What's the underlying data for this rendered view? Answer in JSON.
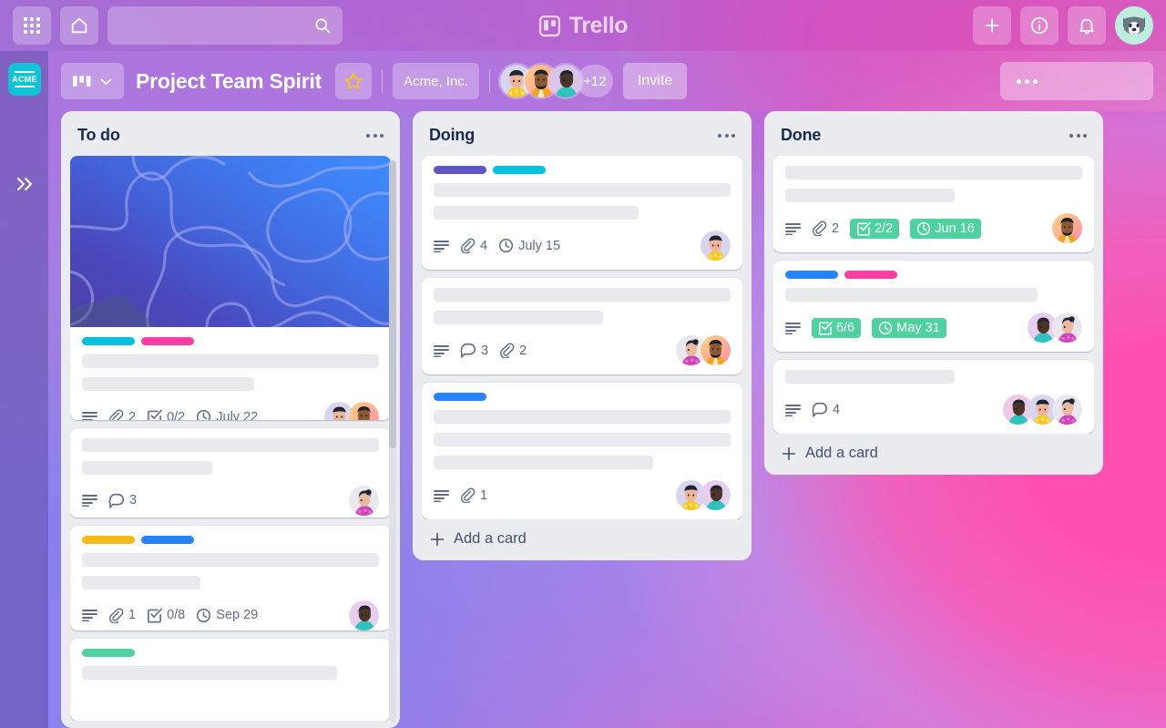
{
  "app": {
    "name": "Trello"
  },
  "topnav": {
    "apps_icon": "grid-apps-icon",
    "home_icon": "home-icon",
    "search": {
      "value": "",
      "placeholder": ""
    },
    "search_icon": "search-icon",
    "create_icon": "plus-icon",
    "info_icon": "info-icon",
    "notifications_icon": "bell-icon",
    "account_avatar": "dog-avatar"
  },
  "rail": {
    "workspace_logo_text": "ACME",
    "expand_icon": "double-chevron-right-icon"
  },
  "boardbar": {
    "view_switcher_icon": "board-view-icon",
    "view_switcher_chevron": "chevron-down-icon",
    "title": "Project Team Spirit",
    "star_icon": "star-icon",
    "workspace": "Acme, Inc.",
    "members_overflow": "+12",
    "invite_label": "Invite",
    "board_menu_icon": "ellipsis-icon"
  },
  "colors": {
    "label_cyan": "#00c2e0",
    "label_pink": "#ff3ea5",
    "label_purple": "#6055c5",
    "label_blue": "#2684ff",
    "label_yellow": "#f5ba1b",
    "label_green": "#4ed2a0",
    "badge_done_green": "#4ed2a0",
    "list_bg": "#ebecf0",
    "acme_logo": "#10c4d5"
  },
  "lists": [
    {
      "title": "To do",
      "menu_icon": "ellipsis-icon",
      "has_scrollbar": true,
      "cards": [
        {
          "cover": "blue-gradient-waves",
          "labels": [
            "#00c2e0",
            "#ff3ea5"
          ],
          "title_lines": [
            100,
            58
          ],
          "badges": [
            {
              "type": "description",
              "icon": "description-icon",
              "text": ""
            },
            {
              "type": "attachment",
              "icon": "paperclip-icon",
              "text": "2"
            },
            {
              "type": "checklist",
              "icon": "checklist-icon",
              "text": "0/2"
            },
            {
              "type": "due",
              "icon": "clock-icon",
              "text": "July 22"
            }
          ],
          "avatars": [
            "yellow-floral",
            "orange-beard"
          ]
        },
        {
          "cover": null,
          "labels": [],
          "title_lines": [
            100,
            44
          ],
          "badges": [
            {
              "type": "description",
              "icon": "description-icon",
              "text": ""
            },
            {
              "type": "comment",
              "icon": "comment-icon",
              "text": "3"
            }
          ],
          "avatars": [
            "magenta-bun"
          ]
        },
        {
          "cover": null,
          "labels": [
            "#f5ba1b",
            "#2684ff"
          ],
          "title_lines": [
            100,
            40
          ],
          "badges": [
            {
              "type": "description",
              "icon": "description-icon",
              "text": ""
            },
            {
              "type": "attachment",
              "icon": "paperclip-icon",
              "text": "1"
            },
            {
              "type": "checklist",
              "icon": "checklist-icon",
              "text": "0/8"
            },
            {
              "type": "due",
              "icon": "clock-icon",
              "text": "Sep 29"
            }
          ],
          "avatars": [
            "teal-shirt"
          ]
        },
        {
          "cover": null,
          "labels": [
            "#4ed2a0"
          ],
          "title_lines": [
            86
          ],
          "badges": [],
          "avatars": []
        }
      ]
    },
    {
      "title": "Doing",
      "menu_icon": "ellipsis-icon",
      "has_scrollbar": false,
      "add_card_label": "Add a card",
      "add_card_icon": "plus-icon",
      "cards": [
        {
          "cover": null,
          "labels": [
            "#6055c5",
            "#00c2e0"
          ],
          "title_lines": [
            100,
            69
          ],
          "badges": [
            {
              "type": "description",
              "icon": "description-icon",
              "text": ""
            },
            {
              "type": "attachment",
              "icon": "paperclip-icon",
              "text": "4"
            },
            {
              "type": "due",
              "icon": "clock-icon",
              "text": "July 15"
            }
          ],
          "avatars": [
            "yellow-floral"
          ]
        },
        {
          "cover": null,
          "labels": [],
          "title_lines": [
            100,
            57
          ],
          "badges": [
            {
              "type": "description",
              "icon": "description-icon",
              "text": ""
            },
            {
              "type": "comment",
              "icon": "comment-icon",
              "text": "3"
            },
            {
              "type": "attachment",
              "icon": "paperclip-icon",
              "text": "2"
            }
          ],
          "avatars": [
            "magenta-bun",
            "orange-beard"
          ]
        },
        {
          "cover": null,
          "labels": [
            "#2684ff"
          ],
          "title_lines": [
            100,
            100,
            74
          ],
          "badges": [
            {
              "type": "description",
              "icon": "description-icon",
              "text": ""
            },
            {
              "type": "attachment",
              "icon": "paperclip-icon",
              "text": "1"
            }
          ],
          "avatars": [
            "yellow-floral",
            "teal-shirt"
          ]
        }
      ]
    },
    {
      "title": "Done",
      "menu_icon": "ellipsis-icon",
      "has_scrollbar": false,
      "add_card_label": "Add a card",
      "add_card_icon": "plus-icon",
      "cards": [
        {
          "cover": null,
          "labels": [],
          "title_lines": [
            100,
            57
          ],
          "badges": [
            {
              "type": "description",
              "icon": "description-icon",
              "text": ""
            },
            {
              "type": "attachment",
              "icon": "paperclip-icon",
              "text": "2"
            },
            {
              "type": "checklist-complete",
              "icon": "checklist-icon",
              "text": "2/2"
            },
            {
              "type": "due-complete",
              "icon": "clock-icon",
              "text": "Jun 16"
            }
          ],
          "avatars": [
            "orange-beard"
          ]
        },
        {
          "cover": null,
          "labels": [
            "#2684ff",
            "#ff3ea5"
          ],
          "title_lines": [
            85
          ],
          "badges": [
            {
              "type": "description",
              "icon": "description-icon",
              "text": ""
            },
            {
              "type": "checklist-complete",
              "icon": "checklist-icon",
              "text": "6/6"
            },
            {
              "type": "due-complete",
              "icon": "clock-icon",
              "text": "May 31"
            }
          ],
          "avatars": [
            "teal-shirt",
            "magenta-bun"
          ]
        },
        {
          "cover": null,
          "labels": [],
          "title_lines": [
            57
          ],
          "badges": [
            {
              "type": "description",
              "icon": "description-icon",
              "text": ""
            },
            {
              "type": "comment",
              "icon": "comment-icon",
              "text": "4"
            }
          ],
          "avatars": [
            "teal-shirt",
            "yellow-floral",
            "magenta-bun"
          ]
        }
      ]
    }
  ]
}
